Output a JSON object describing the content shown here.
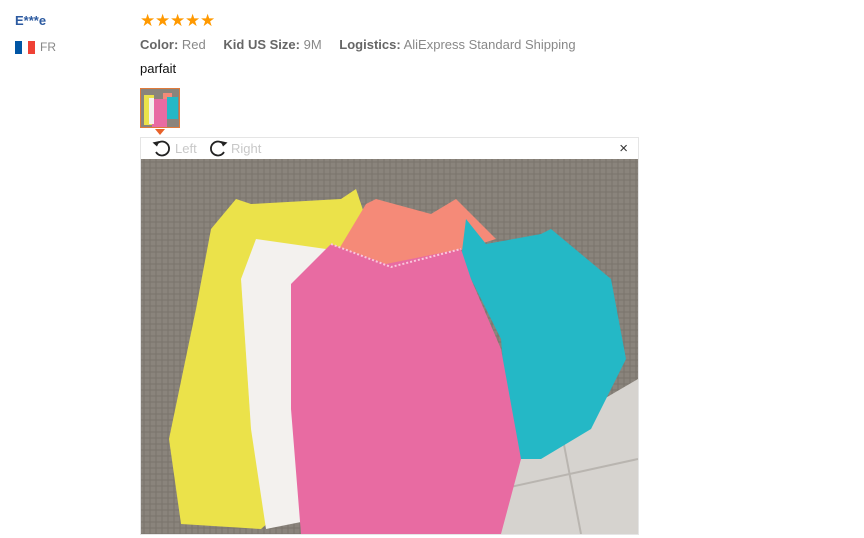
{
  "reviewer": {
    "name": "E***e",
    "country": "FR",
    "flag_colors": [
      "#0055a4",
      "#ffffff",
      "#ef4135"
    ]
  },
  "rating": {
    "stars": 5,
    "max": 5,
    "icon": "star-icon",
    "color": "#ff9900"
  },
  "attributes": [
    {
      "label": "Color:",
      "value": "Red"
    },
    {
      "label": "Kid US Size:",
      "value": "9M"
    },
    {
      "label": "Logistics:",
      "value": "AliExpress Standard Shipping"
    }
  ],
  "review_text": "parfait",
  "viewer": {
    "rotate_left_label": "Left",
    "rotate_right_label": "Right",
    "close_glyph": "×"
  },
  "photo": {
    "subject": "five sleeveless baby bodysuits: yellow, white, coral, pink, turquoise",
    "colors": {
      "couch": "#8a847c",
      "tile": "#d6d3cf",
      "yellow": "#ebe24a",
      "white": "#f3f1ee",
      "coral": "#f58a78",
      "pink": "#e86ba2",
      "turquoise": "#24b8c6"
    }
  }
}
